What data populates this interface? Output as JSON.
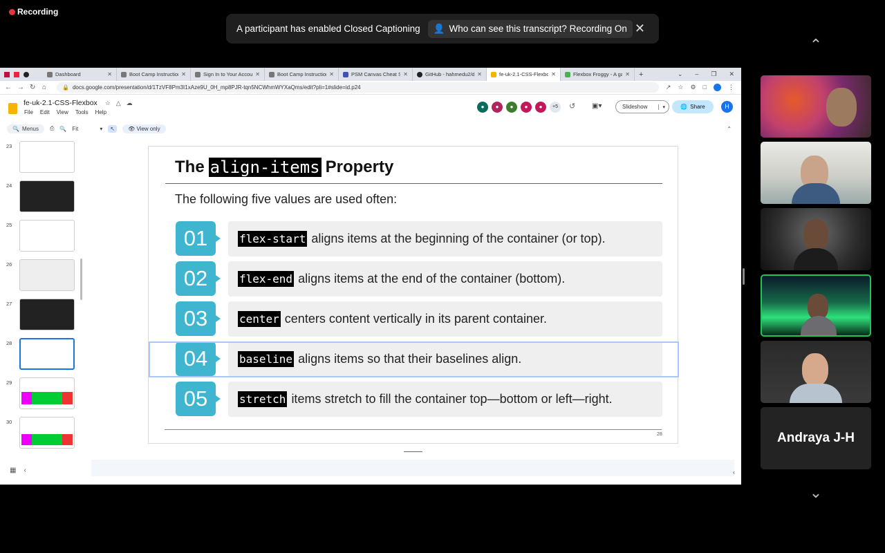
{
  "recording": {
    "label": "Recording"
  },
  "caption_banner": {
    "message": "A participant has enabled Closed Captioning",
    "who_button": "Who can see this transcript? Recording On"
  },
  "browser": {
    "tabs": [
      {
        "label": "Dashboard"
      },
      {
        "label": "Boot Camp Instruction"
      },
      {
        "label": "Sign In to Your Accoun"
      },
      {
        "label": "Boot Camp Instruction"
      },
      {
        "label": "PSM Canvas Cheat She"
      },
      {
        "label": "GitHub - hahmedu2/d"
      },
      {
        "label": "fe-uk-2.1-CSS-Flexbox"
      },
      {
        "label": "Flexbox Froggy - A ga"
      }
    ],
    "url": "docs.google.com/presentation/d/1TzVF8Pm3I1xAze9U_0H_mp8PJR-tqn5NCWhmWYXaQms/edit?pli=1#slide=id.p24"
  },
  "docs": {
    "title": "fe-uk-2.1-CSS-Flexbox",
    "menus": [
      "File",
      "Edit",
      "View",
      "Tools",
      "Help"
    ],
    "collaborator_count": "+5",
    "slideshow_label": "Slideshow",
    "share_label": "Share",
    "profile_initial": "H",
    "search_label": "Menus",
    "zoom_label": "Fit",
    "view_only_label": "View only"
  },
  "thumbnails": [
    {
      "num": "23"
    },
    {
      "num": "24"
    },
    {
      "num": "25"
    },
    {
      "num": "26"
    },
    {
      "num": "27"
    },
    {
      "num": "28"
    },
    {
      "num": "29"
    },
    {
      "num": "30"
    }
  ],
  "slide": {
    "title_pre": "The",
    "title_code": "align-items",
    "title_post": "Property",
    "intro": "The following five values are used often:",
    "items": [
      {
        "num": "01",
        "code": "flex-start",
        "text": "aligns items at the beginning of the container (or top)."
      },
      {
        "num": "02",
        "code": "flex-end",
        "text": "aligns items at the end of the container (bottom)."
      },
      {
        "num": "03",
        "code": "center",
        "text": "centers content vertically in its parent container."
      },
      {
        "num": "04",
        "code": "baseline",
        "text": "aligns items so that their baselines align."
      },
      {
        "num": "05",
        "code": "stretch",
        "text": "items stretch to fill the container top—bottom or left—right."
      }
    ],
    "page_number": "28"
  },
  "participants": {
    "name_tile": "Andraya J-H"
  },
  "colors": {
    "accent_teal": "#3fb5cf",
    "speaker_border": "#23c35b",
    "recording_dot": "#e5343b"
  }
}
